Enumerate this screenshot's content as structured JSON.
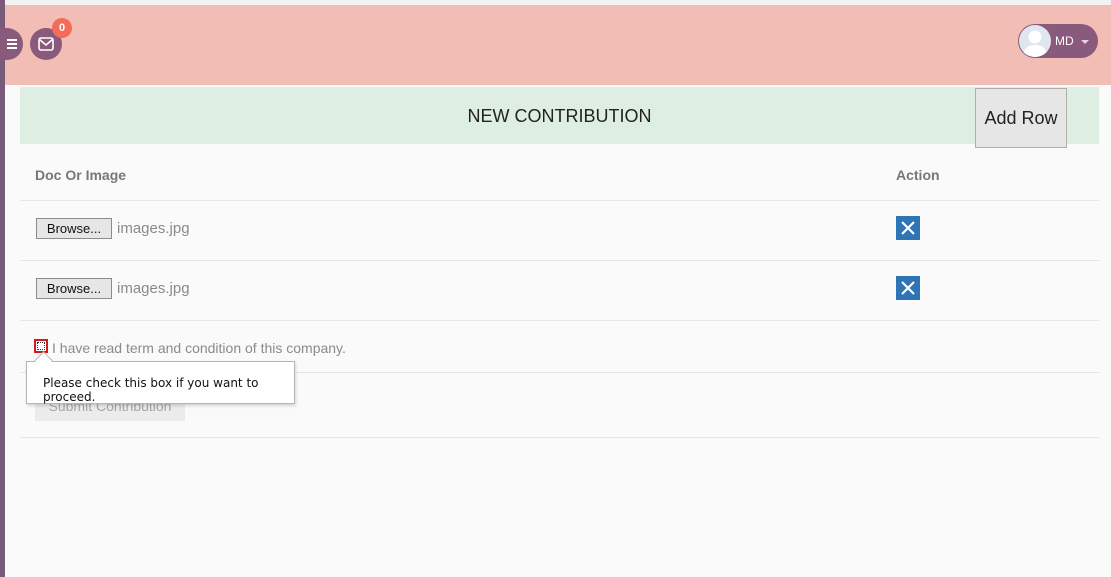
{
  "header": {
    "notification_count": "0",
    "user_initials": "MD",
    "background_color": "#f2bdb4",
    "accent_color": "#8a5a7d",
    "badge_color": "#f26b5b"
  },
  "panel": {
    "title": "NEW CONTRIBUTION",
    "add_row_label": "Add Row",
    "title_bar_color": "#dfeee2"
  },
  "table": {
    "headers": [
      "Doc Or Image",
      "Action"
    ],
    "rows": [
      {
        "browse_label": "Browse...",
        "file_name": "images.jpg"
      },
      {
        "browse_label": "Browse...",
        "file_name": "images.jpg"
      }
    ],
    "delete_button_color": "#2f74b5"
  },
  "form": {
    "terms_label": "I have read term and condition of this company.",
    "submit_label": "Submit Contribution",
    "validation_message": "Please check this box if you want to proceed."
  },
  "icons": {
    "menu": "hamburger-icon",
    "mail": "envelope-icon",
    "avatar": "user-avatar-icon",
    "dropdown": "caret-down-icon",
    "delete": "close-x-icon"
  }
}
